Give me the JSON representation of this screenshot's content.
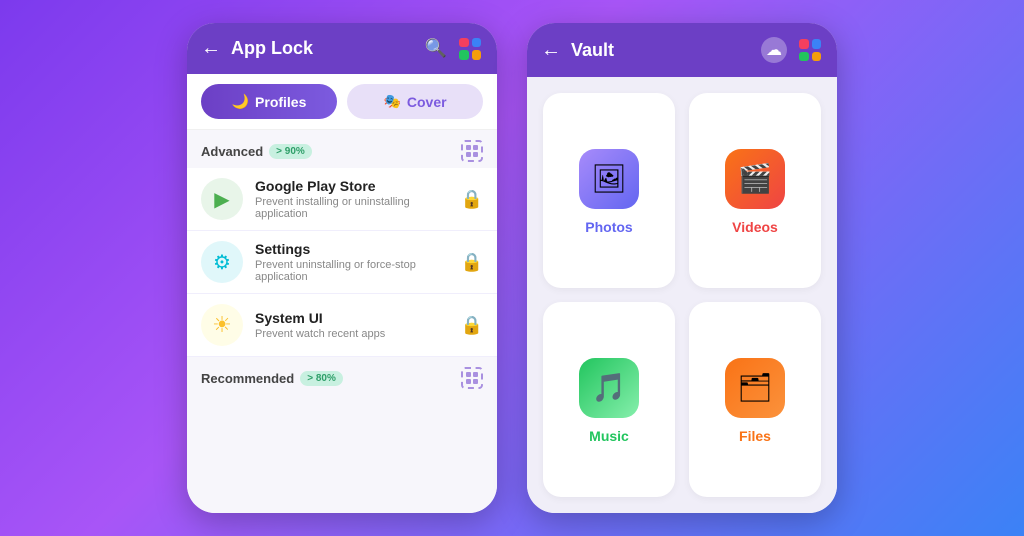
{
  "appLock": {
    "headerTitle": "App Lock",
    "backArrow": "←",
    "tabs": [
      {
        "id": "profiles",
        "label": "Profiles",
        "icon": "🌙",
        "active": true
      },
      {
        "id": "cover",
        "label": "Cover",
        "icon": "🎭",
        "active": false
      }
    ],
    "sections": [
      {
        "id": "advanced",
        "label": "Advanced",
        "badge": "> 90%",
        "apps": [
          {
            "name": "Google Play Store",
            "desc": "Prevent installing or uninstalling application",
            "iconEmoji": "▶",
            "iconBg": "play",
            "locked": true
          },
          {
            "name": "Settings",
            "desc": "Prevent uninstalling or force-stop application",
            "iconEmoji": "⚙",
            "iconBg": "settings",
            "locked": true
          },
          {
            "name": "System UI",
            "desc": "Prevent watch recent apps",
            "iconEmoji": "☀",
            "iconBg": "systemui",
            "locked": false
          }
        ]
      },
      {
        "id": "recommended",
        "label": "Recommended",
        "badge": "> 80%",
        "apps": []
      }
    ]
  },
  "vault": {
    "headerTitle": "Vault",
    "backArrow": "←",
    "cards": [
      {
        "id": "photos",
        "label": "Photos",
        "emoji": "🖼",
        "colorClass": "photos"
      },
      {
        "id": "videos",
        "label": "Videos",
        "emoji": "🎬",
        "colorClass": "videos"
      },
      {
        "id": "music",
        "label": "Music",
        "emoji": "🎵",
        "colorClass": "music"
      },
      {
        "id": "files",
        "label": "Files",
        "emoji": "🗂",
        "colorClass": "files"
      }
    ]
  }
}
